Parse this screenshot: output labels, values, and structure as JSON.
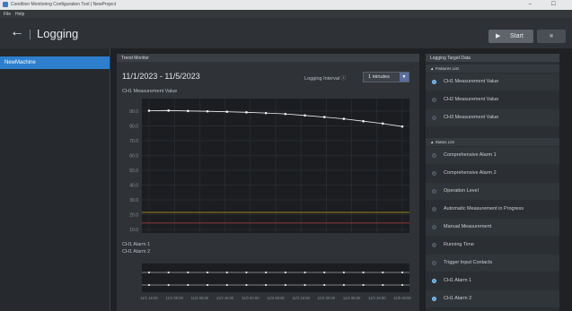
{
  "titlebar": {
    "title": "Condition Monitoring Configuration Tool | NewProject",
    "controls": "–  ☐"
  },
  "menubar": {
    "items": [
      "File",
      "Help"
    ]
  },
  "header": {
    "back_icon": "←",
    "title": "Logging",
    "start_label": "Start",
    "start_icon": "▶",
    "stop_icon": "■"
  },
  "sidebar": {
    "items": [
      {
        "label": "NewMachine",
        "selected": true
      }
    ]
  },
  "trend_monitor": {
    "title": "Trend Monitor",
    "date_range": "11/1/2023 - 11/5/2023",
    "interval_label": "Logging Interval ⓘ",
    "interval_value": "1 minutes",
    "chart1_label": "CH1 Measurement Value",
    "chart2_labels": [
      "CH1 Alarm 1",
      "CH1 Alarm 2"
    ]
  },
  "chart_data": [
    {
      "type": "line",
      "ylabel": "",
      "ylim": [
        10,
        95
      ],
      "yticks": [
        "90.0",
        "80.0",
        "70.0",
        "60.0",
        "50.0",
        "40.0",
        "30.0",
        "20.0",
        "10.0"
      ],
      "series": [
        {
          "name": "CH1 Measurement Value",
          "color": "#f2f2f2",
          "values": [
            90.3,
            90.4,
            90.1,
            89.9,
            89.6,
            89.2,
            88.7,
            88.1,
            87.1,
            86.0,
            84.8,
            83.2,
            81.6,
            79.6
          ]
        }
      ],
      "threshold_lines": [
        {
          "value": 21.5,
          "color": "#c8a020"
        },
        {
          "value": 14.3,
          "color": "#b84040"
        }
      ],
      "grid": true
    },
    {
      "type": "line",
      "categories": [
        "11/1 16:00",
        "11/2 00:00",
        "11/2 08:00",
        "11/2 16:00",
        "11/3 00:00",
        "11/3 08:00",
        "11/3 16:00",
        "11/4 00:00",
        "11/4 08:00",
        "11/4 16:00",
        "11/5 00:00"
      ],
      "series": [
        {
          "name": "CH1 Alarm 1",
          "values": [
            1,
            1,
            1,
            1,
            1,
            1,
            1,
            1,
            1,
            1,
            1,
            1,
            1,
            1
          ],
          "color": "#e0e0e0"
        },
        {
          "name": "CH1 Alarm 2",
          "values": [
            0,
            0,
            0,
            0,
            0,
            0,
            0,
            0,
            0,
            0,
            0,
            0,
            0,
            0
          ],
          "color": "#e0e0e0"
        }
      ]
    }
  ],
  "logging_target": {
    "title": "Logging Target Data",
    "sections": [
      {
        "label": "▲ Features List",
        "items": [
          {
            "label": "CH1 Measurement Value",
            "checked": true
          },
          {
            "label": "CH2 Measurement Value",
            "checked": false
          },
          {
            "label": "CH3 Measurement Value",
            "checked": false
          }
        ]
      },
      {
        "label": "▲ Status List",
        "items": [
          {
            "label": "Comprehensive Alarm 1",
            "checked": false
          },
          {
            "label": "Comprehensive Alarm 2",
            "checked": false
          },
          {
            "label": "Operation Level",
            "checked": false
          },
          {
            "label": "Automatic Measurement in Progress",
            "checked": false
          },
          {
            "label": "Manual Measurement",
            "checked": false
          },
          {
            "label": "Running Time",
            "checked": false
          },
          {
            "label": "Trigger Input Contacts",
            "checked": false
          },
          {
            "label": "CH1 Alarm 1",
            "checked": true
          },
          {
            "label": "CH1 Alarm 2",
            "checked": true
          }
        ]
      }
    ]
  }
}
